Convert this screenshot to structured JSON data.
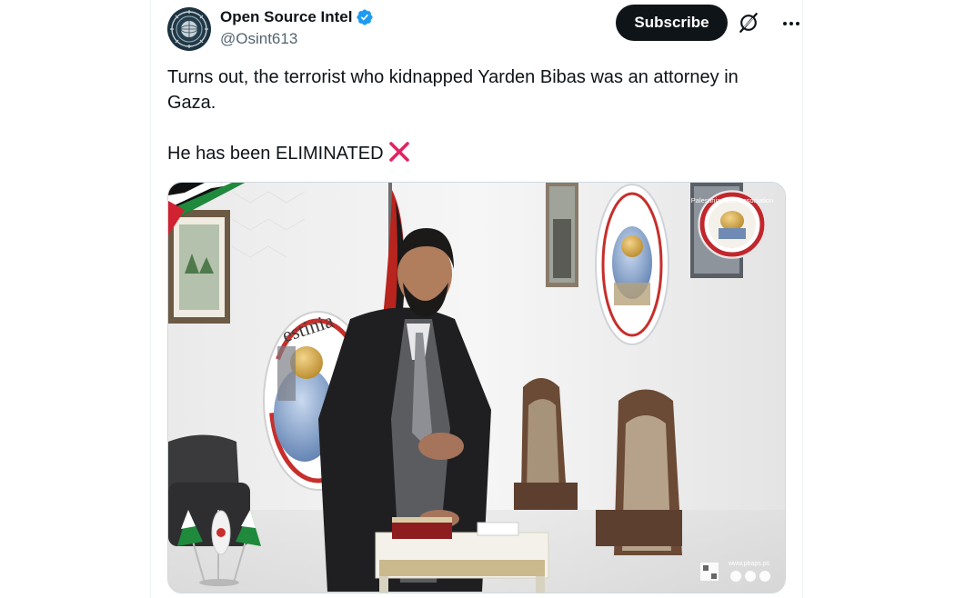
{
  "author": {
    "display_name": "Open Source Intel",
    "handle": "@Osint613",
    "verified": true,
    "avatar_icon": "globe-emblem-avatar"
  },
  "actions": {
    "subscribe_label": "Subscribe",
    "grok_icon": "grok-icon",
    "more_icon": "more-dots-icon"
  },
  "tweet": {
    "text_line1": "Turns out, the terrorist who kidnapped Yarden Bibas was an attorney in Gaza.",
    "text_line2": "He has been ELIMINATED",
    "emoji": "cross-mark-icon"
  },
  "media": {
    "logo_text": "Palestinian Bar Association",
    "emblem_text": "estinia",
    "watermark_url": "www.pbaps.ps"
  },
  "colors": {
    "subscribe_bg": "#0f1419",
    "verified_blue": "#1d9bf0",
    "handle_gray": "#536471",
    "cross_red": "#e0245e"
  }
}
